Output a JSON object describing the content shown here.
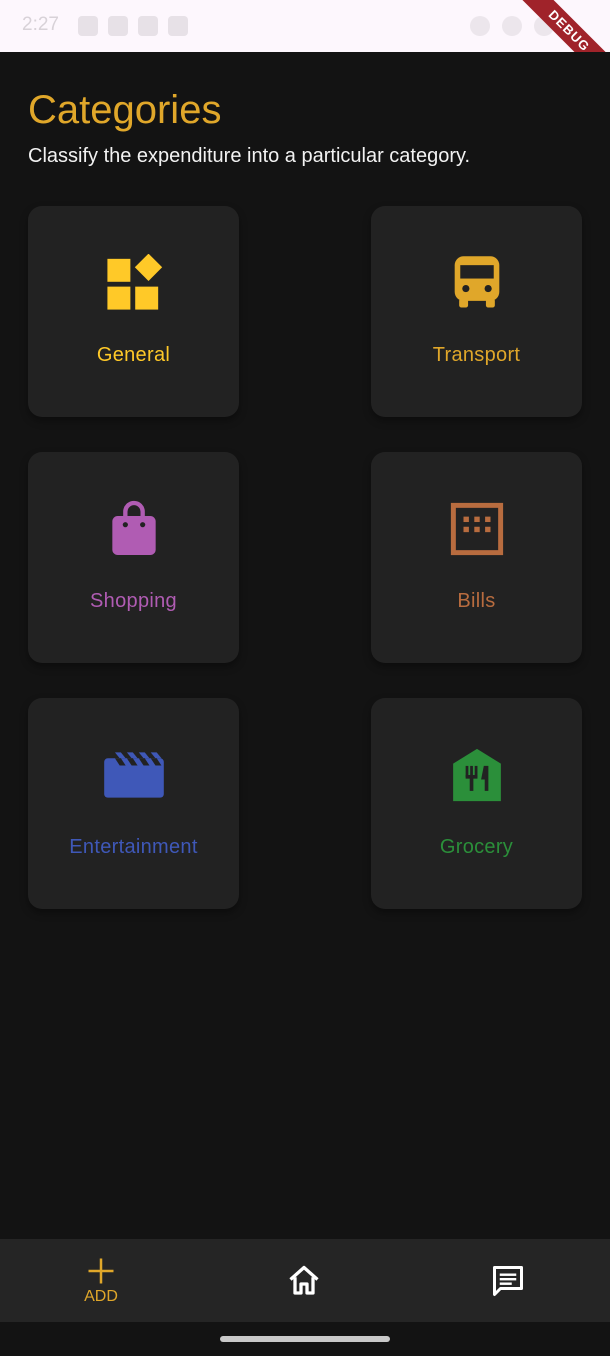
{
  "status_bar": {
    "time": "2:27"
  },
  "debug_banner": "DEBUG",
  "header": {
    "title": "Categories",
    "subtitle": "Classify the expenditure into a particular category."
  },
  "categories": [
    {
      "label": "General",
      "icon": "widgets-icon",
      "color": "#ffc928"
    },
    {
      "label": "Transport",
      "icon": "bus-icon",
      "color": "#e0a72a"
    },
    {
      "label": "Shopping",
      "icon": "shopping-bag-icon",
      "color": "#b05cb3"
    },
    {
      "label": "Bills",
      "icon": "calendar-grid-icon",
      "color": "#b86c3f"
    },
    {
      "label": "Entertainment",
      "icon": "movie-clapper-icon",
      "color": "#3f58b8"
    },
    {
      "label": "Grocery",
      "icon": "store-restaurant-icon",
      "color": "#2b8f3a"
    }
  ],
  "bottom_nav": {
    "add_label": "ADD",
    "add_icon": "plus-icon",
    "home_icon": "home-icon",
    "chat_icon": "chat-icon"
  },
  "colors": {
    "accent": "#e0a72a",
    "background": "#131313",
    "card": "#222222"
  }
}
